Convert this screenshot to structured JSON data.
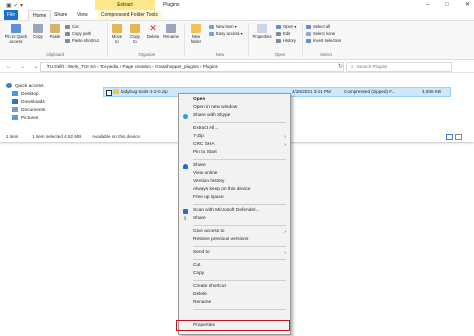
{
  "window": {
    "title": "Plugins",
    "contextual_tab": "Extract",
    "controls": [
      "–",
      "□",
      "✕"
    ]
  },
  "tabs": [
    {
      "label": "File"
    },
    {
      "label": "Home"
    },
    {
      "label": "Share"
    },
    {
      "label": "View"
    },
    {
      "label": "Compressed Folder Tools"
    }
  ],
  "ribbon": {
    "pin_to_quick_access": "Pin to Quick access",
    "copy": "Copy",
    "paste": "Paste",
    "cut": "Cut",
    "copy_path": "Copy path",
    "paste_shortcut": "Paste shortcut",
    "move_to": "Move to",
    "copy_to": "Copy to",
    "delete": "Delete",
    "rename": "Rename",
    "new_folder": "New folder",
    "new_item": "New item ▾",
    "easy_access": "Easy access ▾",
    "properties": "Properties",
    "open": "Open ▾",
    "edit": "Edit",
    "history": "History",
    "select_all": "Select all",
    "select_none": "Select none",
    "invert_selection": "Invert selection",
    "groups": {
      "clipboard": "Clipboard",
      "organize": "Organize",
      "new": "New",
      "open": "Open",
      "select": "Select"
    }
  },
  "address": {
    "path": "TU Delft  ›  Werk_TOI SA  ›  Toi-pedia  ›  Page creation  ›  Grasshopper_plugins  ›  Plugins",
    "search_placeholder": "Search Plugins"
  },
  "nav": {
    "items": [
      "Quick access",
      "Desktop",
      "Downloads",
      "Documents",
      "Pictures"
    ]
  },
  "file": {
    "name": "ladybug-tools-1-2-0.zip",
    "date": "4/26/2021 3:41 PM",
    "type": "Compressed (zipped) F...",
    "size": "4,938 KB"
  },
  "status": {
    "count": "1 item",
    "selected": "1 item selected  4.82 MB",
    "availability": "Available on this device"
  },
  "context_menu": {
    "open": "Open",
    "open_new_window": "Open in new window",
    "share_skype": "Share with Skype",
    "extract_all": "Extract All...",
    "seven_zip": "7-Zip",
    "crc_sha": "CRC SHA",
    "pin_to_start": "Pin to Start",
    "share": "Share",
    "view_online": "View online",
    "version_history": "Version history",
    "always_keep": "Always keep on this device",
    "free_up_space": "Free up space",
    "scan_defender": "Scan with Microsoft Defender...",
    "share2": "Share",
    "give_access": "Give access to",
    "restore_versions": "Restore previous versions",
    "send_to": "Send to",
    "cut": "Cut",
    "copy": "Copy",
    "create_shortcut": "Create shortcut",
    "delete": "Delete",
    "rename": "Rename",
    "properties": "Properties"
  },
  "colors": {
    "file_tab": "#1a73c9",
    "contextual_tab": "#fce88a",
    "selection": "#cce8ff",
    "highlight_box": "#c0141e"
  }
}
